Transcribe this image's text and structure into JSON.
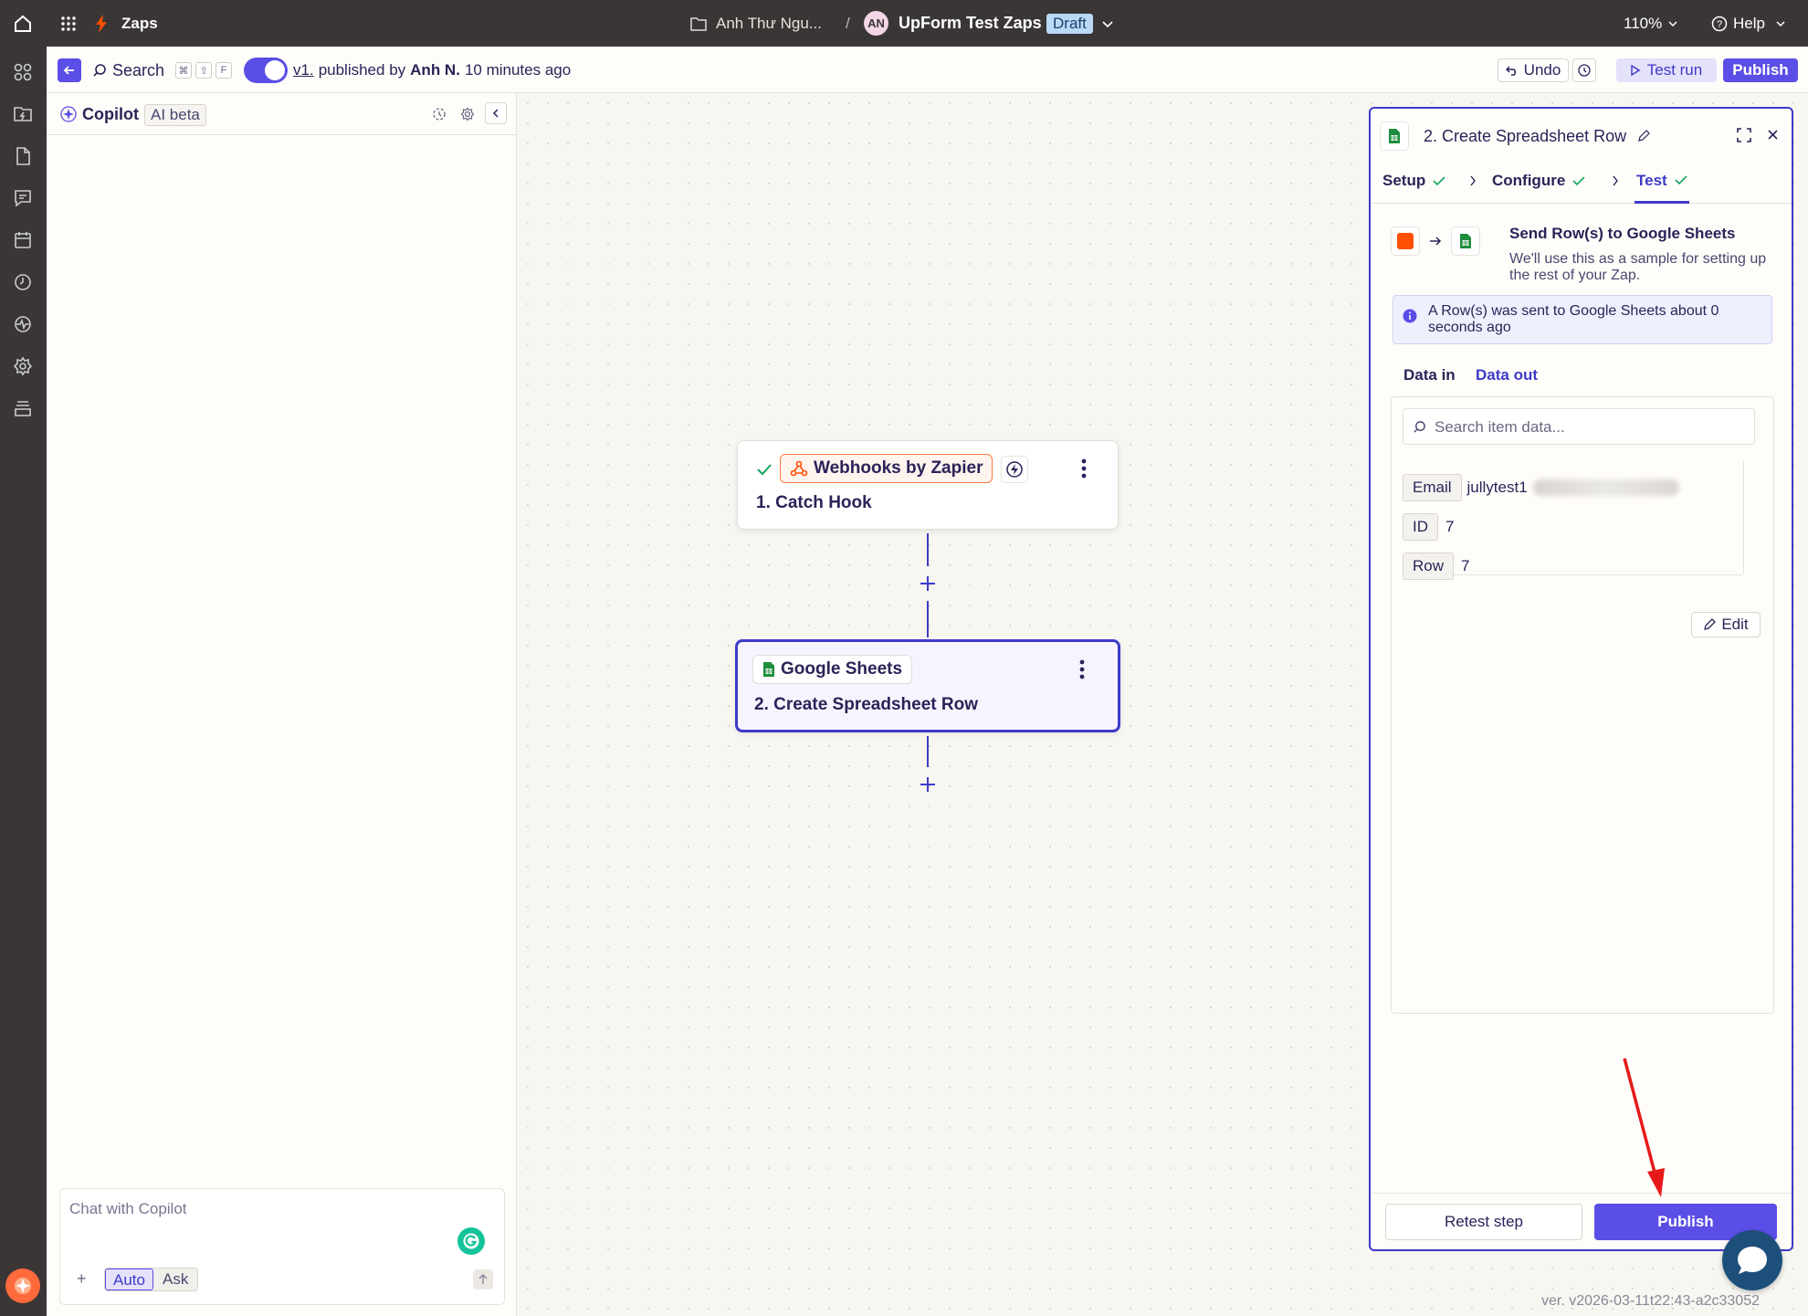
{
  "topbar": {
    "app_title": "Zaps",
    "folder": "Anh Thư Ngu...",
    "separator": "/",
    "avatar_initials": "AN",
    "zap_name": "UpForm Test Zaps",
    "status_badge": "Draft",
    "zoom": "110%",
    "help": "Help"
  },
  "toolbar": {
    "search_label": "Search",
    "kbd_keys": [
      "⌘",
      "⇧",
      "F"
    ],
    "version": "v1.",
    "published_prefix": "published by",
    "published_by": "Anh N.",
    "published_time": "10 minutes ago",
    "undo_label": "Undo",
    "test_run_label": "Test run",
    "publish_label": "Publish"
  },
  "copilot": {
    "title": "Copilot",
    "badge": "AI beta",
    "chat_placeholder": "Chat with Copilot",
    "mode_auto": "Auto",
    "mode_ask": "Ask"
  },
  "canvas": {
    "node1": {
      "app": "Webhooks by Zapier",
      "step": "1. Catch Hook"
    },
    "node2": {
      "app": "Google Sheets",
      "step": "2. Create Spreadsheet Row"
    }
  },
  "panel": {
    "title": "2. Create Spreadsheet Row",
    "tabs": [
      {
        "label": "Setup"
      },
      {
        "label": "Configure"
      },
      {
        "label": "Test"
      }
    ],
    "sample_title": "Send Row(s) to Google Sheets",
    "sample_desc": "We'll use this as a sample for setting up the rest of your Zap.",
    "info_text": "A Row(s) was sent to Google Sheets about 0 seconds ago",
    "data_tabs": {
      "data_in": "Data in",
      "data_out": "Data out"
    },
    "search_placeholder": "Search item data...",
    "fields": [
      {
        "key": "Email",
        "value": "jullytest1"
      },
      {
        "key": "ID",
        "value": "7"
      },
      {
        "key": "Row",
        "value": "7"
      }
    ],
    "edit_label": "Edit",
    "retest_label": "Retest step",
    "publish_label": "Publish"
  },
  "version_string": "ver. v2026-03-11t22:43-a2c33052",
  "colors": {
    "topbar_bg": "#3a3636",
    "accent": "#3d3ac9",
    "zapier_orange": "#ff4f00",
    "sheets_green": "#1e8e3e",
    "success_green": "#13a55e"
  }
}
